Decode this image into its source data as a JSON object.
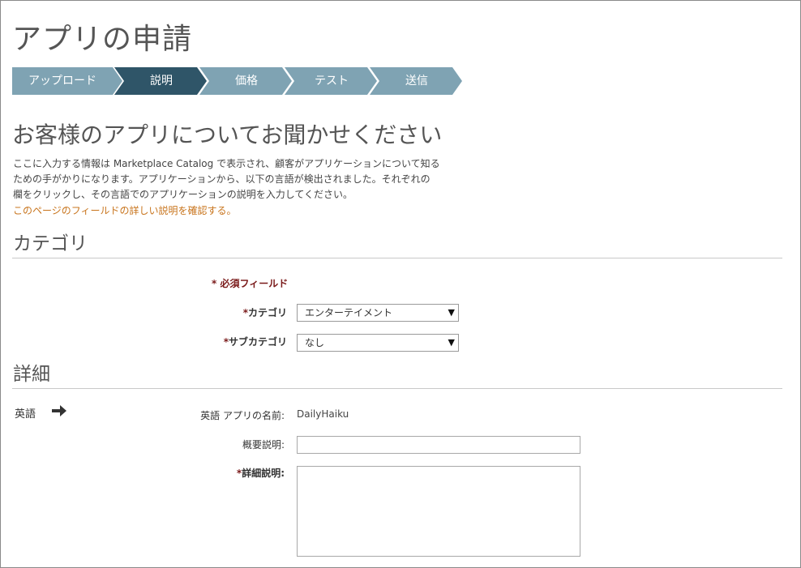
{
  "page": {
    "title": "アプリの申請"
  },
  "steps": [
    {
      "label": "アップロード",
      "state": "done"
    },
    {
      "label": "説明",
      "state": "active"
    },
    {
      "label": "価格",
      "state": "pending"
    },
    {
      "label": "テスト",
      "state": "pending"
    },
    {
      "label": "送信",
      "state": "pending"
    }
  ],
  "colors": {
    "step_inactive": "#7fa3b3",
    "step_active": "#2f5568",
    "required_star": "#7a1a1a",
    "link": "#c8741c"
  },
  "intro": {
    "heading": "お客様のアプリについてお聞かせください",
    "lines": [
      "ここに入力する情報は Marketplace Catalog で表示され、顧客がアプリケーションについて知る",
      "ための手がかりになります。アプリケーションから、以下の言語が検出されました。それぞれの",
      "欄をクリックし、その言語でのアプリケーションの説明を入力してください。"
    ],
    "link": "このページのフィールドの詳しい説明を確認する。"
  },
  "category_section": {
    "title": "カテゴリ",
    "required_note": "* 必須フィールド",
    "category": {
      "label": "カテゴリ",
      "value": "エンターテイメント"
    },
    "subcategory": {
      "label": "サブカテゴリ",
      "value": "なし"
    }
  },
  "details_section": {
    "title": "詳細",
    "language": "英語",
    "arrow_icon": "arrow-right-icon",
    "app_name_label": "英語 アプリの名前:",
    "app_name_value": "DailyHaiku",
    "summary_label": "概要説明:",
    "summary_value": "",
    "detail_label": "詳細説明:",
    "detail_value": ""
  }
}
